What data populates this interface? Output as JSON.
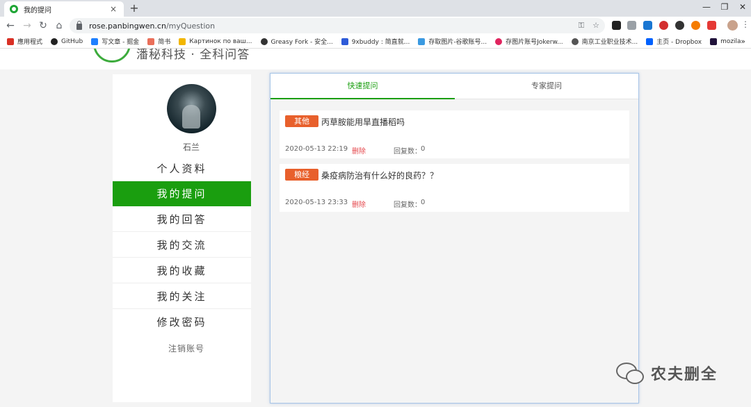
{
  "browser": {
    "tab_title": "我的提问",
    "tab_close": "×",
    "new_tab": "+",
    "window_controls": [
      "—",
      "❐",
      "✕"
    ],
    "url_host": "rose.panbingwen.cn",
    "url_path": "/myQuestion",
    "bookmarks": [
      {
        "label": "應用程式",
        "color": "#d93025"
      },
      {
        "label": "GitHub",
        "color": "#222222"
      },
      {
        "label": "写文章 - 掘金",
        "color": "#1e80ff"
      },
      {
        "label": "简书",
        "color": "#ea6f5a"
      },
      {
        "label": "Картинок по ваш...",
        "color": "#f2b600"
      },
      {
        "label": "Greasy Fork - 安全...",
        "color": "#333333"
      },
      {
        "label": "9xbuddy : 简直就...",
        "color": "#2e5bd8"
      },
      {
        "label": "存取图片-谷歌账号...",
        "color": "#3b9ae1"
      },
      {
        "label": "存图片账号Jokerw...",
        "color": "#e0245e"
      },
      {
        "label": "南京工业职业技术...",
        "color": "#555555"
      },
      {
        "label": "主页 - Dropbox",
        "color": "#0061fe"
      },
      {
        "label": "mozila",
        "color": "#20123a"
      }
    ],
    "bookmarks_more": "»"
  },
  "site": {
    "logo_text": "潘秘科技 · 全科问答"
  },
  "sidebar": {
    "username": "石兰",
    "menu": [
      {
        "label": "个人资料",
        "active": false
      },
      {
        "label": "我的提问",
        "active": true
      },
      {
        "label": "我的回答",
        "active": false
      },
      {
        "label": "我的交流",
        "active": false
      },
      {
        "label": "我的收藏",
        "active": false
      },
      {
        "label": "我的关注",
        "active": false
      },
      {
        "label": "修改密码",
        "active": false
      }
    ],
    "logout": "注销账号"
  },
  "main": {
    "tabs": [
      {
        "label": "快速提问",
        "active": true
      },
      {
        "label": "专家提问",
        "active": false
      }
    ],
    "questions": [
      {
        "tag": "其他",
        "title": "丙草胺能用旱直播稻吗",
        "date": "2020-05-13 22:19",
        "delete_label": "删除",
        "reply_label": "回复数：",
        "reply_count": "0"
      },
      {
        "tag": "粮经",
        "title": "桑疫病防治有什么好的良药？？",
        "date": "2020-05-13 23:33",
        "delete_label": "删除",
        "reply_label": "回复数：",
        "reply_count": "0"
      }
    ]
  },
  "watermark": {
    "text": "农夫删全"
  },
  "colors": {
    "brand_green": "#1a9e0f",
    "tag_orange": "#e8602c",
    "delete_red": "#e5484d"
  }
}
